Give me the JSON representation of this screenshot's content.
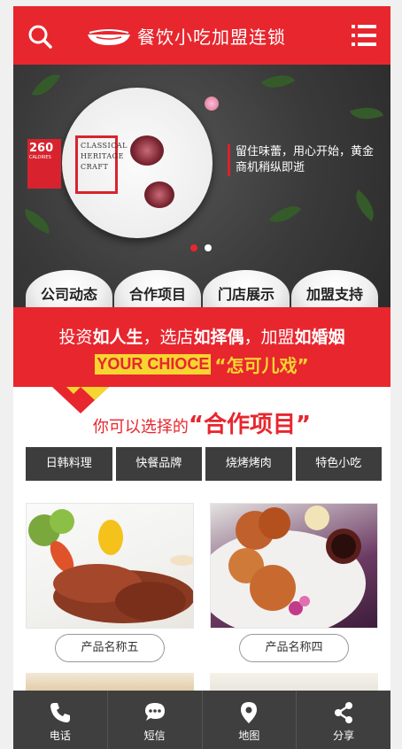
{
  "header": {
    "title": "餐饮小吃加盟连锁",
    "search_icon": "search-icon",
    "menu_icon": "menu-icon",
    "brand_color": "#e8262e"
  },
  "banner": {
    "badge_number": "260",
    "badge_unit": "CALORIES",
    "heritage": "CLASSICAL HERITAGE CRAFT",
    "slogan": "留住味蕾，用心开始，黄金商机稍纵即逝",
    "slides": 2,
    "active_slide": 1
  },
  "tabs": [
    {
      "label": "公司动态"
    },
    {
      "label": "合作项目"
    },
    {
      "label": "门店展示"
    },
    {
      "label": "加盟支持"
    }
  ],
  "promo": {
    "line1_a": "投资",
    "line1_b": "如人生",
    "line1_c": "，选店",
    "line1_d": "如择偶",
    "line1_e": "，加盟",
    "line1_f": "如婚姻",
    "your_choice": "YOUR CHIOCE",
    "quote": "“怎可儿戏”"
  },
  "section": {
    "small": "你可以选择的",
    "big": "“合作项目”"
  },
  "categories": [
    {
      "label": "日韩料理"
    },
    {
      "label": "快餐品牌"
    },
    {
      "label": "烧烤烤肉"
    },
    {
      "label": "特色小吃"
    }
  ],
  "products": [
    {
      "name": "产品名称五"
    },
    {
      "name": "产品名称四"
    }
  ],
  "bottom_bar": [
    {
      "label": "电话",
      "icon": "phone-icon"
    },
    {
      "label": "短信",
      "icon": "sms-icon"
    },
    {
      "label": "地图",
      "icon": "map-pin-icon"
    },
    {
      "label": "分享",
      "icon": "share-icon"
    }
  ]
}
